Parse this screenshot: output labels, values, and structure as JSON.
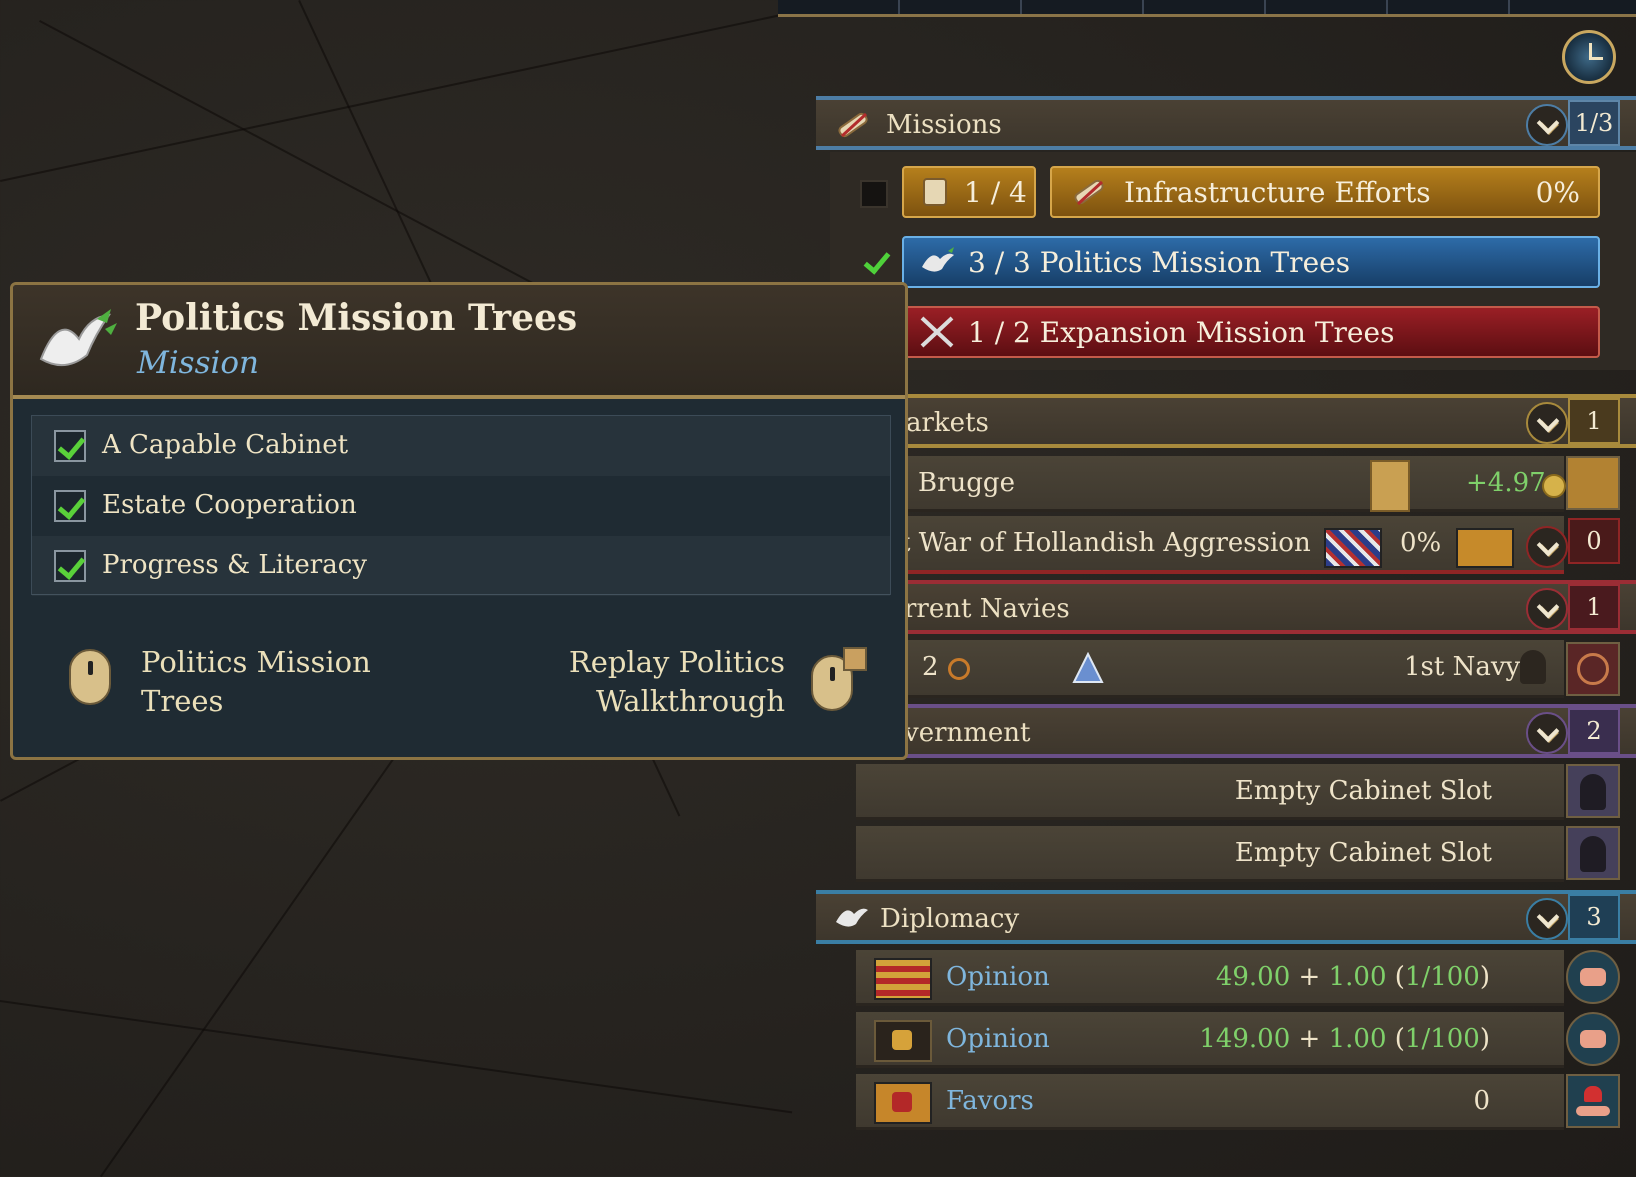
{
  "missions": {
    "label": "Missions",
    "count": "1/3",
    "rows": {
      "infra_progress": "1 / 4",
      "infra_label": "Infrastructure Efforts",
      "infra_percent": "0%",
      "politics_label": "3 / 3 Politics Mission Trees",
      "expansion_label": "1 / 2 Expansion Mission Trees"
    }
  },
  "markets": {
    "label": "arkets",
    "count": "1",
    "row": {
      "name": "Brugge",
      "value": "+4.97"
    }
  },
  "war": {
    "label": "t War of Hollandish Aggression",
    "percent": "0%",
    "count": "0"
  },
  "navies": {
    "label": "rrent Navies",
    "count": "1",
    "row": {
      "ships": "2",
      "name": "1st Navy"
    }
  },
  "government": {
    "label": "vernment",
    "count": "2",
    "slots": [
      "Empty Cabinet Slot",
      "Empty Cabinet Slot"
    ]
  },
  "diplomacy": {
    "label": "Diplomacy",
    "count": "3",
    "rows": [
      {
        "label": "Opinion",
        "base": "49.00",
        "plus": "+",
        "add": "1.00",
        "paren_open": "(",
        "frac": "1/100",
        "paren_close": ")"
      },
      {
        "label": "Opinion",
        "base": "149.00",
        "plus": "+",
        "add": "1.00",
        "paren_open": "(",
        "frac": "1/100",
        "paren_close": ")"
      },
      {
        "label": "Favors",
        "value": "0"
      }
    ]
  },
  "tooltip": {
    "title": "Politics Mission Trees",
    "subtitle": "Mission",
    "items": [
      "A Capable Cabinet",
      "Estate Cooperation",
      "Progress & Literacy"
    ],
    "left_action": [
      "Politics Mission",
      "Trees"
    ],
    "right_action": [
      "Replay Politics",
      "Walkthrough"
    ]
  },
  "colors": {
    "missions_accent": "#4d7da5",
    "markets_accent": "#a88a3c",
    "war_accent": "#8f2525",
    "navies_accent": "#9b2d35",
    "government_accent": "#6a4f88",
    "diplomacy_accent": "#3a7ea4",
    "green_value": "#7fd06a",
    "link_blue": "#7fb6dd"
  }
}
